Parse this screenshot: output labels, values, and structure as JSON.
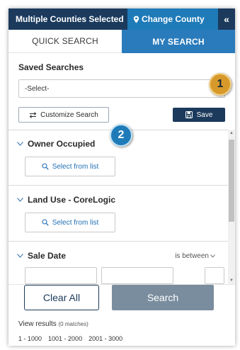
{
  "topbar": {
    "title": "Multiple Counties Selected",
    "change_county": "Change County",
    "collapse": "«"
  },
  "tabs": [
    {
      "label": "QUICK SEARCH",
      "active": false
    },
    {
      "label": "MY SEARCH",
      "active": true
    }
  ],
  "saved": {
    "label": "Saved Searches",
    "select_value": "-Select-",
    "customize_label": "Customize Search",
    "save_label": "Save"
  },
  "filters": [
    {
      "title": "Owner Occupied",
      "button": "Select from list"
    },
    {
      "title": "Land Use - CoreLogic",
      "button": "Select from list"
    }
  ],
  "sale": {
    "title": "Sale Date",
    "operator": "is between"
  },
  "footer": {
    "clear_label": "Clear All",
    "search_label": "Search",
    "view_label": "View results",
    "matches": "(0 matches)",
    "pages": [
      "1 - 1000",
      "1001 - 2000",
      "2001 - 3000"
    ]
  },
  "callouts": [
    "1",
    "2"
  ],
  "colors": {
    "navy": "#1b3a5c",
    "accent_blue": "#2a7bbc",
    "gold_badge": "#d79a2a",
    "search_disabled": "#7a8d9e"
  }
}
